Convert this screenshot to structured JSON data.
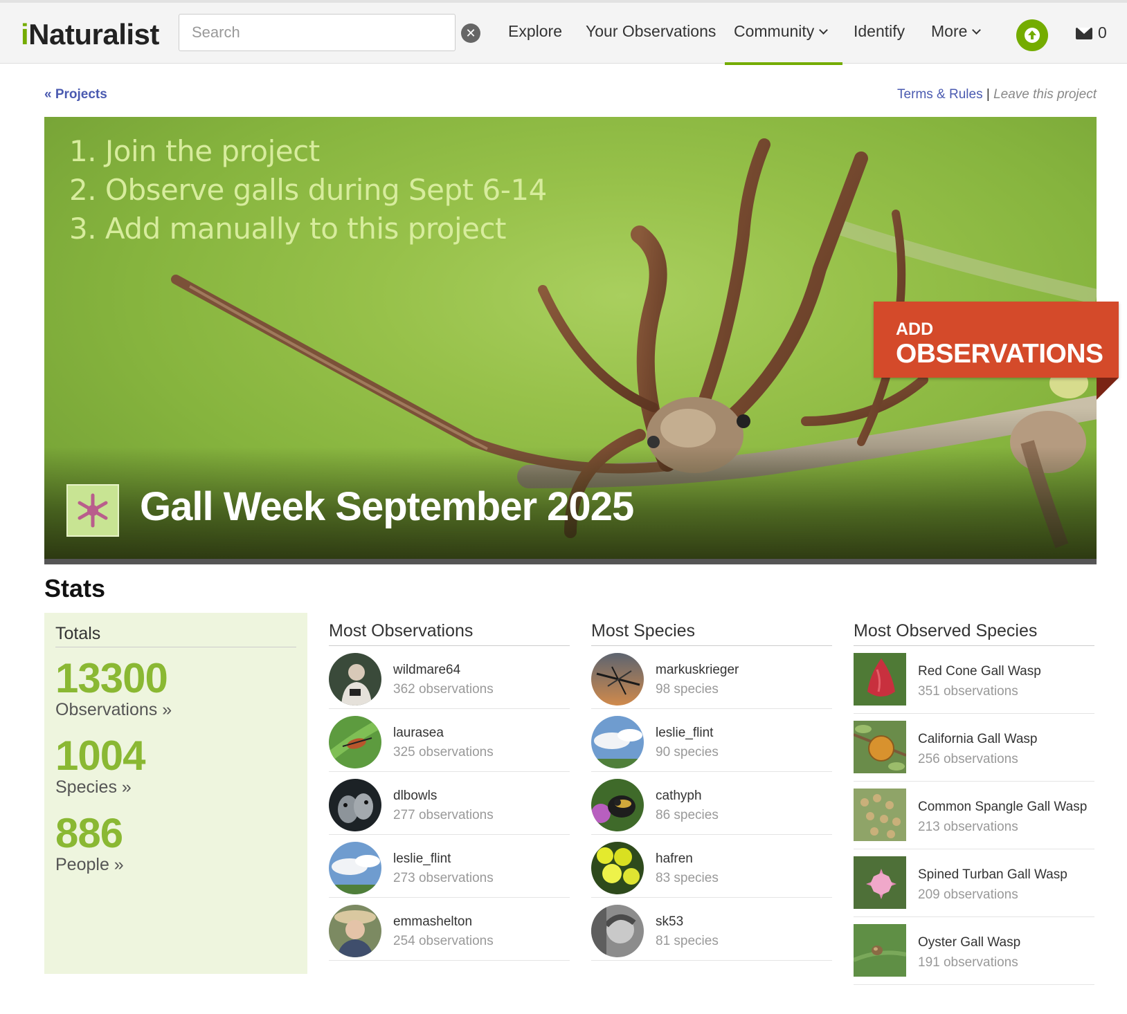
{
  "header": {
    "logo": {
      "i": "i",
      "rest": "Naturalist"
    },
    "search": {
      "placeholder": "Search",
      "value": ""
    },
    "nav": {
      "explore": "Explore",
      "your_observations": "Your Observations",
      "community": "Community",
      "identify": "Identify",
      "more": "More"
    },
    "messages_count": "0"
  },
  "breadcrumb": {
    "projects": "« Projects"
  },
  "project_links": {
    "terms": "Terms & Rules",
    "separator": "|",
    "leave": "Leave this project"
  },
  "banner": {
    "instructions": [
      "1. Join the project",
      "2. Observe galls during Sept 6-14",
      "3. Add manually to this project"
    ],
    "title": "Gall Week September 2025",
    "add_button": {
      "small": "ADD",
      "big": "OBSERVATIONS"
    }
  },
  "stats": {
    "heading": "Stats",
    "totals": {
      "heading": "Totals",
      "observations": {
        "value": "13300",
        "label": "Observations »"
      },
      "species": {
        "value": "1004",
        "label": "Species »"
      },
      "people": {
        "value": "886",
        "label": "People »"
      }
    },
    "most_observations": {
      "heading": "Most Observations",
      "items": [
        {
          "name": "wildmare64",
          "sub": "362 observations",
          "avatar": "person-binoculars"
        },
        {
          "name": "laurasea",
          "sub": "325 observations",
          "avatar": "beetle"
        },
        {
          "name": "dlbowls",
          "sub": "277 observations",
          "avatar": "owls"
        },
        {
          "name": "leslie_flint",
          "sub": "273 observations",
          "avatar": "sky"
        },
        {
          "name": "emmashelton",
          "sub": "254 observations",
          "avatar": "person-hat"
        }
      ]
    },
    "most_species": {
      "heading": "Most Species",
      "items": [
        {
          "name": "markuskrieger",
          "sub": "98 species",
          "avatar": "dragonfly"
        },
        {
          "name": "leslie_flint",
          "sub": "90 species",
          "avatar": "sky"
        },
        {
          "name": "cathyph",
          "sub": "86 species",
          "avatar": "bee"
        },
        {
          "name": "hafren",
          "sub": "83 species",
          "avatar": "yellow-flowers"
        },
        {
          "name": "sk53",
          "sub": "81 species",
          "avatar": "child-bw"
        }
      ]
    },
    "most_observed_species": {
      "heading": "Most Observed Species",
      "items": [
        {
          "name": "Red Cone Gall Wasp",
          "sub": "351 observations",
          "photo": "red-cone-gall"
        },
        {
          "name": "California Gall Wasp",
          "sub": "256 observations",
          "photo": "oak-apple-gall"
        },
        {
          "name": "Common Spangle Gall Wasp",
          "sub": "213 observations",
          "photo": "spangle-galls"
        },
        {
          "name": "Spined Turban Gall Wasp",
          "sub": "209 observations",
          "photo": "spined-turban-gall"
        },
        {
          "name": "Oyster Gall Wasp",
          "sub": "191 observations",
          "photo": "oyster-gall"
        }
      ]
    }
  },
  "colors": {
    "brand_green": "#74ac00",
    "stat_green": "#8ab833",
    "add_button": "#d44a2a",
    "link_blue": "#4a5ab0",
    "totals_bg": "#eef5de"
  }
}
